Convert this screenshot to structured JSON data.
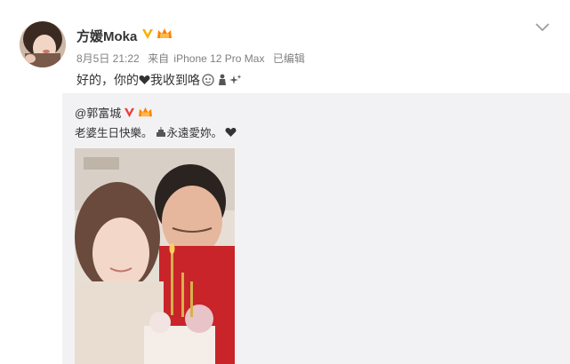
{
  "post": {
    "username": "方媛Moka",
    "meta": {
      "date": "8月5日 21:22",
      "source_prefix": "来自",
      "source_device": "iPhone 12 Pro Max",
      "edited": "已编辑"
    },
    "text": "好的，你的",
    "text_tail": "我收到咯",
    "icons": {
      "verified": "verified-v-icon",
      "vip": "crown-vip-icon",
      "menu": "chevron-down-icon"
    }
  },
  "repost": {
    "author": "@郭富城",
    "text_main": "老婆生日快樂。",
    "text_tail": "永遠愛妳。",
    "photo_caption_icon": "cake-photo"
  },
  "colors": {
    "repost_bg": "#f2f2f5",
    "verified": "#f5b100",
    "crown": "#ff8200",
    "heart": "#333333"
  }
}
